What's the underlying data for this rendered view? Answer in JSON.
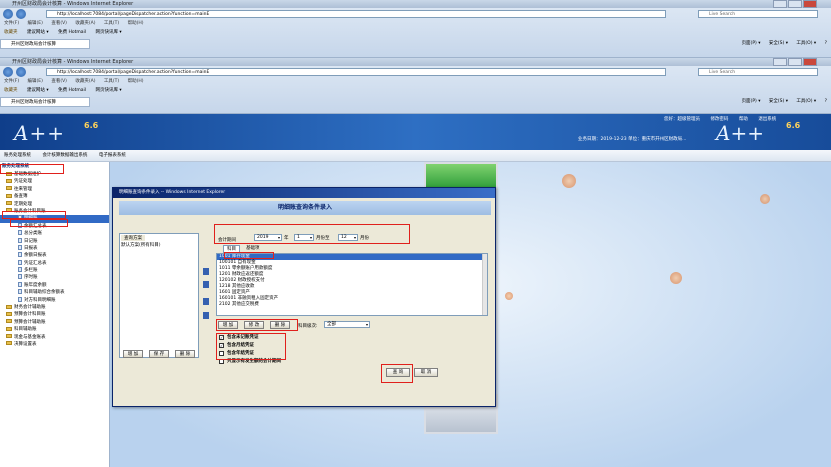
{
  "ie1": {
    "title": "开州区财政局会计核算 - Windows Internet Explorer",
    "url": "http://localhost:7084/portal/pageDispatcher.action?function=mainE",
    "live_search": "Live Search",
    "menu": [
      "文件(F)",
      "编辑(E)",
      "查看(V)",
      "收藏夹(A)",
      "工具(T)",
      "帮助(H)"
    ],
    "fav_label": "收藏夹",
    "fav_items": [
      "建议网站 ▾",
      "免费 Hotmail",
      "网页快讯库 ▾"
    ],
    "tab": "开州区财政局会计核算",
    "tools": [
      "页面(P) ▾",
      "安全(S) ▾",
      "工具(O) ▾",
      "?"
    ]
  },
  "ie2": {
    "title": "开州区财政局会计核算 - Windows Internet Explorer",
    "url": "http://localhost:7084/portal/pageDispatcher.action?function=mainE",
    "live_search": "Live Search",
    "menu": [
      "文件(F)",
      "编辑(E)",
      "查看(V)",
      "收藏夹(A)",
      "工具(T)",
      "帮助(H)"
    ],
    "fav_label": "收藏夹",
    "fav_items": [
      "建议网站 ▾",
      "免费 Hotmail",
      "网页快讯库 ▾"
    ],
    "tab": "开州区财政局会计核算",
    "tools": [
      "页面(P) ▾",
      "安全(S) ▾",
      "工具(O) ▾",
      "?"
    ]
  },
  "banner": {
    "logo": "A++",
    "version": "6.6",
    "links": [
      "您好：超级管理员",
      "修改密码",
      "帮助",
      "退出系统"
    ],
    "status": "业务日期：2019-12-23   单位：重庆市开州区财政局..."
  },
  "sysbar": [
    "账务处理系统",
    "会计核算数据输出系统",
    "电子报表系统"
  ],
  "sidebar": {
    "head": "账务处理系统",
    "items": [
      {
        "label": "基础数据维护",
        "type": "folder",
        "indent": 1
      },
      {
        "label": "凭证处理",
        "type": "folder",
        "indent": 1
      },
      {
        "label": "往来管理",
        "type": "folder",
        "indent": 1
      },
      {
        "label": "备查簿",
        "type": "folder",
        "indent": 1
      },
      {
        "label": "定期处理",
        "type": "folder",
        "indent": 1
      },
      {
        "label": "账务会计科目账",
        "type": "folder",
        "indent": 1
      },
      {
        "label": "明细账",
        "type": "leaf",
        "indent": 2
      },
      {
        "label": "余额汇总表",
        "type": "leaf",
        "indent": 2
      },
      {
        "label": "总分类账",
        "type": "leaf",
        "indent": 2
      },
      {
        "label": "日记账",
        "type": "leaf",
        "indent": 2
      },
      {
        "label": "日报表",
        "type": "leaf",
        "indent": 2
      },
      {
        "label": "余额日报表",
        "type": "leaf",
        "indent": 2
      },
      {
        "label": "凭证汇总表",
        "type": "leaf",
        "indent": 2
      },
      {
        "label": "多栏账",
        "type": "leaf",
        "indent": 2
      },
      {
        "label": "序时账",
        "type": "leaf",
        "indent": 2
      },
      {
        "label": "账年度余额",
        "type": "leaf",
        "indent": 2
      },
      {
        "label": "科目辅助综合余额表",
        "type": "leaf",
        "indent": 2
      },
      {
        "label": "对方科目明细账",
        "type": "leaf",
        "indent": 2
      },
      {
        "label": "财务会计辅助账",
        "type": "folder",
        "indent": 1
      },
      {
        "label": "预算会计科目账",
        "type": "folder",
        "indent": 1
      },
      {
        "label": "预算会计辅助账",
        "type": "folder",
        "indent": 1
      },
      {
        "label": "科目辅助账",
        "type": "folder",
        "indent": 1
      },
      {
        "label": "现金与基金账表",
        "type": "folder",
        "indent": 1
      },
      {
        "label": "决算设置表",
        "type": "folder",
        "indent": 1
      }
    ]
  },
  "dialog": {
    "title": "明细账查询条件录入 -- Windows Internet Explorer",
    "header": "明细账查询条件录入",
    "scheme_tab": "查询方案",
    "scheme_selected": "默认方案(所有科目)",
    "buttons_left": [
      "增 加",
      "保 存",
      "删 除"
    ],
    "period_label": "会计期间",
    "year": "2019",
    "year_unit": "年",
    "month_from": "1",
    "month_from_unit": "月份至",
    "month_to": "12",
    "month_to_unit": "月份",
    "tabs": [
      "科目",
      "基础项"
    ],
    "accounts": [
      "1001 库存现金",
      "100101 自有现金",
      "1011 零余额账户用款额度",
      "1201 财政应返还额度",
      "120102 财政授权支付",
      "1218 其他应收款",
      "1601 固定资产",
      "160101 非融资租入固定资产",
      "2102 其他应交税费"
    ],
    "buttons_mid": [
      "增 加",
      "修 改",
      "删 除"
    ],
    "level_label": "科目级次:",
    "level_value": "全部",
    "checks": [
      {
        "label": "包含未记账凭证",
        "checked": true
      },
      {
        "label": "包含月结凭证",
        "checked": true
      },
      {
        "label": "包含年结凭证",
        "checked": false
      },
      {
        "label": "只显示有发生额的会计期间",
        "checked": false
      }
    ],
    "query_btn": "查 询",
    "cancel_btn": "取 消"
  },
  "colors": {
    "banner": "#1a4f9c",
    "highlight": "#e0201c",
    "selection": "#316ac5"
  }
}
